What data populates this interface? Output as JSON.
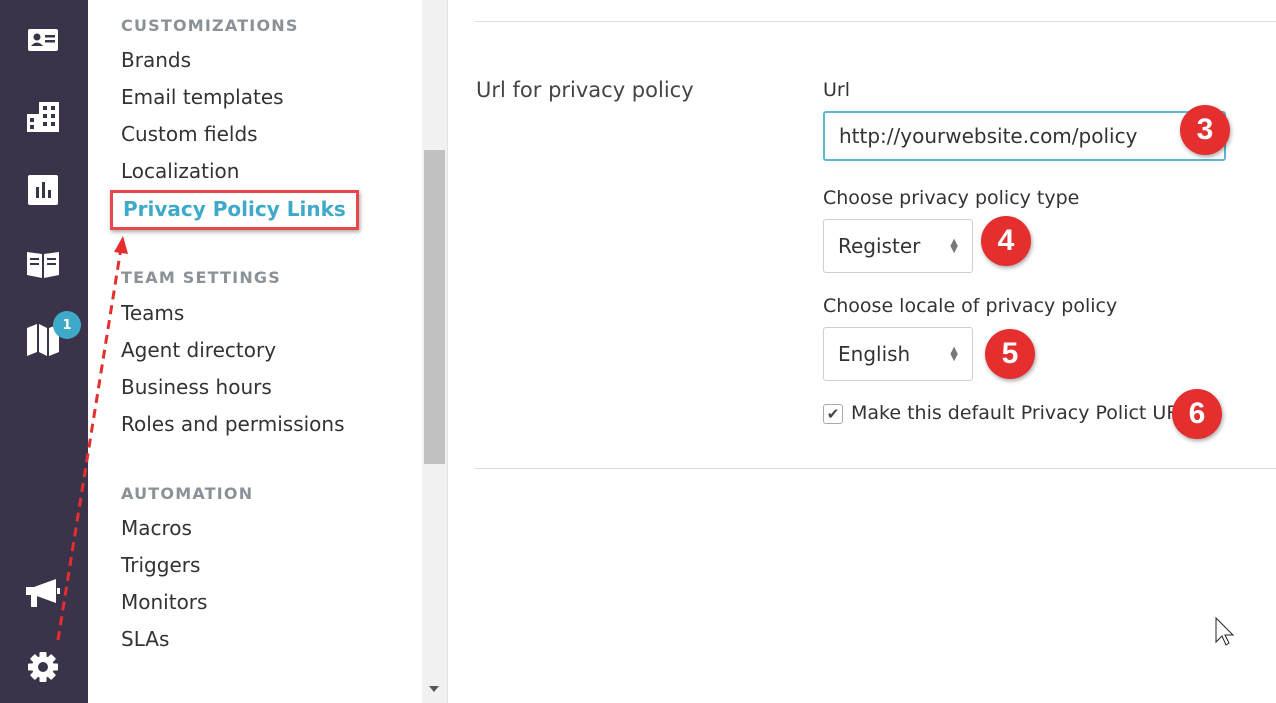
{
  "rail": {
    "icons": [
      "contact-card-icon",
      "organizations-icon",
      "reports-icon",
      "knowledge-base-icon",
      "map-icon",
      "megaphone-icon",
      "gear-icon"
    ],
    "badge_count": "1",
    "bg_color": "#3b3349"
  },
  "menu": {
    "customizations": {
      "title": "CUSTOMIZATIONS",
      "items": [
        "Brands",
        "Email templates",
        "Custom fields",
        "Localization"
      ],
      "active": "Privacy Policy Links"
    },
    "team_settings": {
      "title": "TEAM SETTINGS",
      "items": [
        "Teams",
        "Agent directory",
        "Business hours",
        "Roles and permissions"
      ]
    },
    "automation": {
      "title": "AUTOMATION",
      "items": [
        "Macros",
        "Triggers",
        "Monitors",
        "SLAs"
      ]
    }
  },
  "content": {
    "section_label": "Url for privacy policy",
    "url_label": "Url",
    "url_value": "http://yourwebsite.com/policy",
    "type_label": "Choose privacy policy type",
    "type_value": "Register",
    "locale_label": "Choose locale of privacy policy",
    "locale_value": "English",
    "default_checkbox_label": "Make this default Privacy Polict URL",
    "default_checked": true
  },
  "annotations": {
    "steps": [
      "3",
      "4",
      "5",
      "6"
    ],
    "color": "#e52e2e"
  },
  "colors": {
    "accent": "#3fa9c9",
    "highlight_border": "#e5474b"
  }
}
